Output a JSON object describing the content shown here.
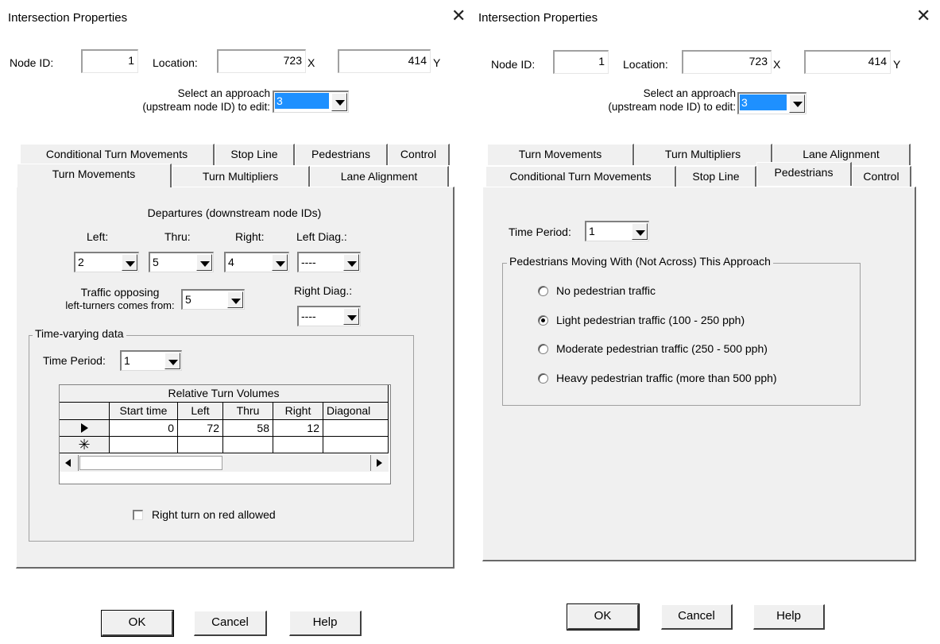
{
  "left_dialog": {
    "title": "Intersection Properties",
    "node_id_label": "Node ID:",
    "node_id": "1",
    "location_label": "Location:",
    "location_x": "723",
    "x_suffix": "X",
    "location_y": "414",
    "y_suffix": "Y",
    "approach_label_1": "Select an approach",
    "approach_label_2": "(upstream node ID) to edit:",
    "approach_value": "3",
    "tabs_row_back": [
      "Conditional Turn Movements",
      "Stop Line",
      "Pedestrians",
      "Control"
    ],
    "tabs_row_front": [
      "Turn Movements",
      "Turn Multipliers",
      "Lane Alignment"
    ],
    "active_tab": "Turn Movements",
    "departures_header": "Departures (downstream node IDs)",
    "left_label": "Left:",
    "thru_label": "Thru:",
    "right_label": "Right:",
    "left_diag_label": "Left Diag.:",
    "left_value": "2",
    "thru_value": "5",
    "right_value": "4",
    "left_diag_value": "----",
    "opposing_label_1": "Traffic opposing",
    "opposing_label_2": "left-turners comes from:",
    "opposing_value": "5",
    "right_diag_label": "Right Diag.:",
    "right_diag_value": "----",
    "time_varying_label": "Time-varying data",
    "time_period_label": "Time Period:",
    "time_period_value": "1",
    "grid_title": "Relative Turn Volumes",
    "grid_columns": [
      "Start time",
      "Left",
      "Thru",
      "Right",
      "Diagonal"
    ],
    "grid_row": [
      "0",
      "72",
      "58",
      "12",
      ""
    ],
    "rtor_label": "Right turn on red allowed",
    "rtor_checked": false,
    "ok": "OK",
    "cancel": "Cancel",
    "help": "Help"
  },
  "right_dialog": {
    "title": "Intersection Properties",
    "node_id_label": "Node ID:",
    "node_id": "1",
    "location_label": "Location:",
    "location_x": "723",
    "x_suffix": "X",
    "location_y": "414",
    "y_suffix": "Y",
    "approach_label_1": "Select an approach",
    "approach_label_2": "(upstream node ID) to edit:",
    "approach_value": "3",
    "tabs_row_back": [
      "Turn Movements",
      "Turn Multipliers",
      "Lane Alignment"
    ],
    "tabs_row_front": [
      "Conditional Turn Movements",
      "Stop Line",
      "Pedestrians",
      "Control"
    ],
    "active_tab": "Pedestrians",
    "time_period_label": "Time Period:",
    "time_period_value": "1",
    "ped_group_label": "Pedestrians Moving With (Not Across) This Approach",
    "ped_options": [
      "No pedestrian traffic",
      "Light pedestrian traffic (100 - 250 pph)",
      "Moderate pedestrian traffic  (250 - 500 pph)",
      "Heavy pedestrian traffic  (more than 500 pph)"
    ],
    "ped_selected_index": 1,
    "ok": "OK",
    "cancel": "Cancel",
    "help": "Help"
  },
  "icons": {
    "close": "close-icon",
    "dropdown": "chevron-down-icon",
    "row_pointer": "current-row-icon",
    "new_row": "new-row-asterisk-icon",
    "scroll_left": "scroll-left-icon",
    "scroll_right": "scroll-right-icon"
  },
  "colors": {
    "selection": "#1e90ff",
    "panel": "#f0f0f0"
  }
}
